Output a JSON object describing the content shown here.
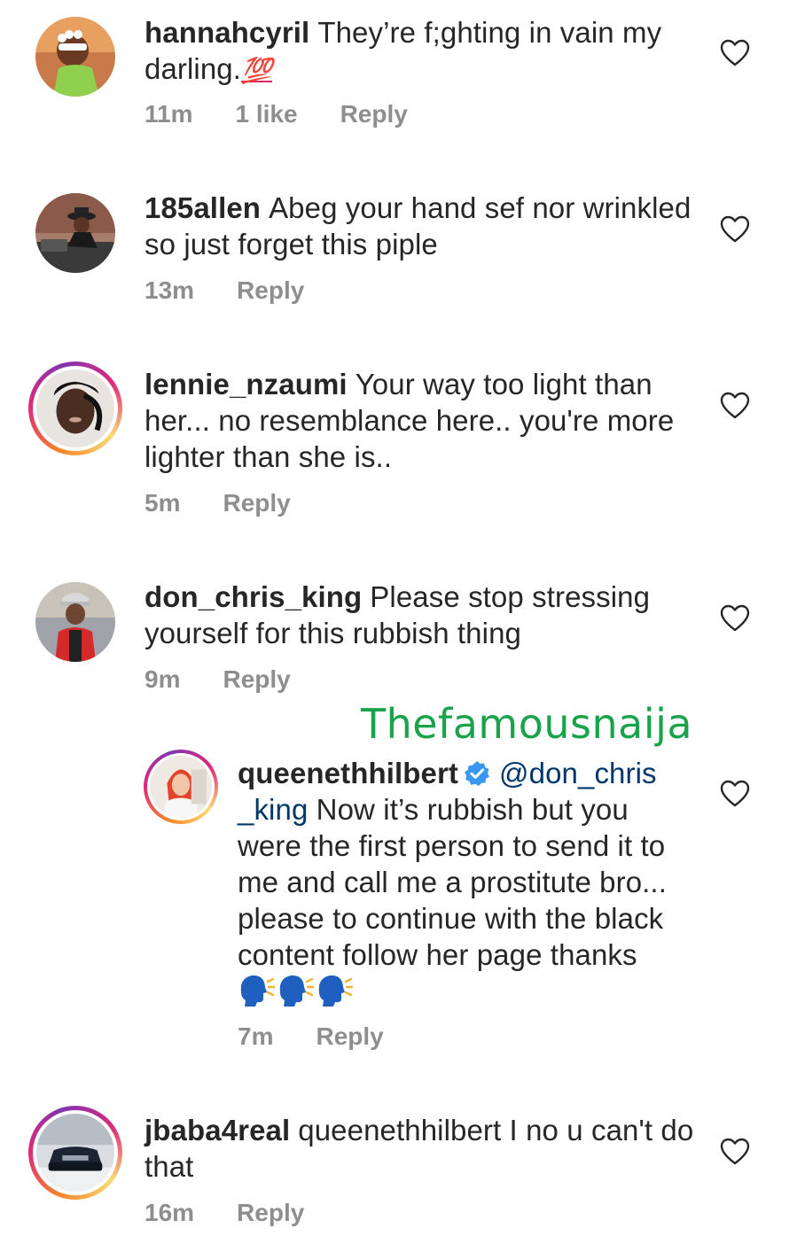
{
  "watermark": "Thefamousnaija",
  "comments": [
    {
      "username": "hannahcyril",
      "text": "They’re f;ghting in vain my darling.",
      "emoji": "💯",
      "time": "11m",
      "likes": "1 like",
      "reply": "Reply"
    },
    {
      "username": "185allen",
      "text": "Abeg your hand sef nor wrinkled so just forget this piple",
      "time": "13m",
      "reply": "Reply"
    },
    {
      "username": "lennie_nzaumi",
      "text": "Your way too light than her... no resemblance here.. you're more lighter than she is..",
      "time": "5m",
      "reply": "Reply"
    },
    {
      "username": "don_chris_king",
      "text": "Please stop stressing yourself for this rubbish thing",
      "time": "9m",
      "reply": "Reply"
    },
    {
      "username": "queenethhilbert",
      "mention": "@don_chris _king",
      "text": "Now it’s rubbish but you were the first person to send it to me and call me a prostitute bro... please to continue with the black content follow her page thanks",
      "time": "7m",
      "reply": "Reply"
    },
    {
      "username": "jbaba4real",
      "text": "queenethhilbert I no u can't do that",
      "time": "16m",
      "reply": "Reply"
    }
  ],
  "icons": {
    "like": "heart-outline-icon",
    "verified": "verified-badge-icon",
    "speaking": "speaking-head-emoji"
  },
  "colors": {
    "text": "#262626",
    "meta": "#8e8e8e",
    "mention": "#00376b",
    "verified": "#3897f0",
    "watermark": "#1aa34a"
  }
}
